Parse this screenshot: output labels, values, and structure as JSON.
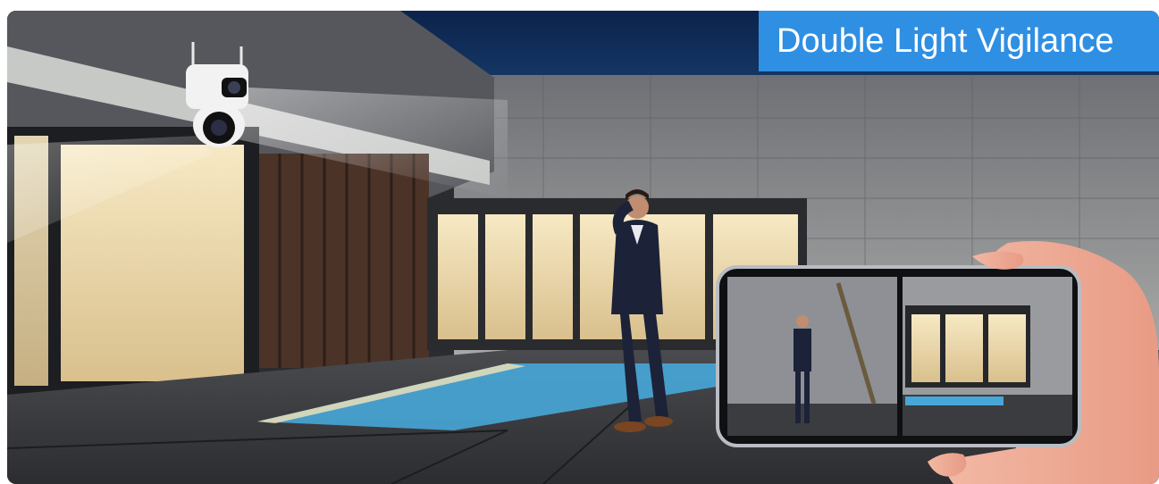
{
  "banner": {
    "title": "Double Light Vigilance"
  },
  "colors": {
    "banner_bg": "#2f8fe3",
    "night_sky": "#0e2a55",
    "wall_stone": "#8a8c90",
    "warm_light": "#f3e3b8",
    "pool_water": "#47a7d8"
  },
  "icons": {
    "camera": "dual-lens-security-camera",
    "phone": "smartphone-live-view"
  }
}
